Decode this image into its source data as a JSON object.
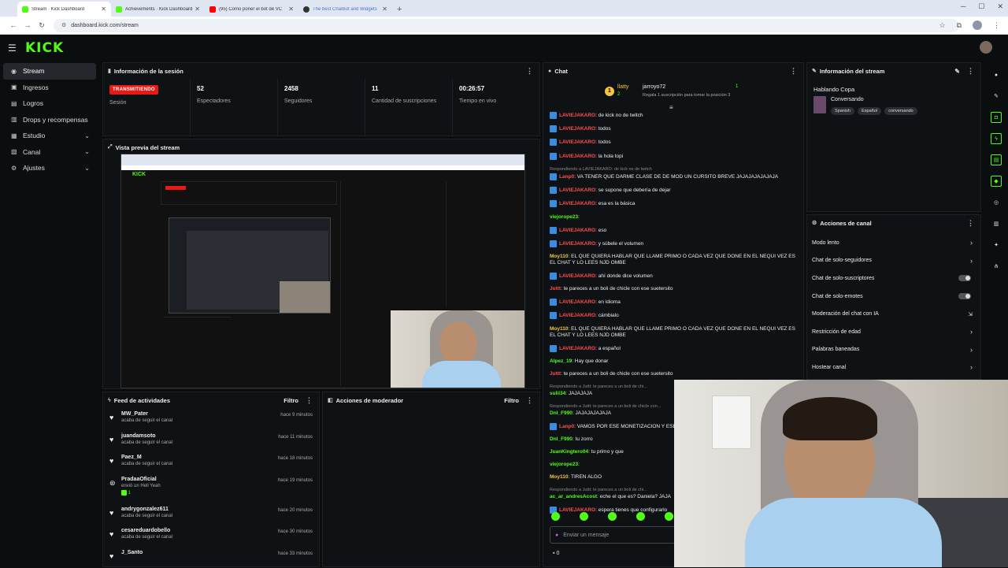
{
  "browser": {
    "tabs": [
      {
        "label": "Stream · Kick Dashboard",
        "color": "#53fc18",
        "active": true
      },
      {
        "label": "Achievements · Kick Dashboard",
        "color": "#53fc18",
        "active": false
      },
      {
        "label": "(95) Como poner el bot de VC",
        "color": "#ff0000",
        "active": false
      },
      {
        "label": "The best ChatBot and Widgets",
        "color": "#333333",
        "active": false
      }
    ],
    "url": "dashboard.kick.com/stream"
  },
  "brand": {
    "logo": "KICK",
    "accent": "#53fc18"
  },
  "sidebar": {
    "items": [
      {
        "label": "Stream",
        "icon": "broadcast-icon",
        "active": true
      },
      {
        "label": "Ingresos",
        "icon": "money-icon"
      },
      {
        "label": "Logros",
        "icon": "trophy-icon"
      },
      {
        "label": "Drops y recompensas",
        "icon": "gift-icon"
      },
      {
        "label": "Estudio",
        "icon": "studio-icon",
        "chevron": true
      },
      {
        "label": "Canal",
        "icon": "channel-icon",
        "chevron": true
      },
      {
        "label": "Ajustes",
        "icon": "settings-icon",
        "chevron": true
      }
    ]
  },
  "session": {
    "title": "Información de la sesión",
    "live_label": "TRANSMITIENDO",
    "session_label": "Sesión",
    "stats": [
      {
        "value": "52",
        "label": "Espectadores"
      },
      {
        "value": "2458",
        "label": "Seguidores"
      },
      {
        "value": "11",
        "label": "Cantidad de suscripciones"
      },
      {
        "value": "00:26:57",
        "label": "Tiempo en vivo"
      }
    ]
  },
  "preview": {
    "title": "Vista previa del stream"
  },
  "feed": {
    "title": "Feed de actividades",
    "filter": "Filtro",
    "items": [
      {
        "name": "MW_Pater",
        "sub": "acaba de seguir el canal",
        "time": "hace 9 minutos"
      },
      {
        "name": "juandamsoto",
        "sub": "acaba de seguir el canal",
        "time": "hace 11 minutos"
      },
      {
        "name": "Paez_M",
        "sub": "acaba de seguir el canal",
        "time": "hace 18 minutos"
      },
      {
        "name": "PradaaOficial",
        "sub": "envió un Hell Yeah",
        "extra": "1",
        "time": "hace 19 minutos"
      },
      {
        "name": "andrygonzalez611",
        "sub": "acaba de seguir el canal",
        "time": "hace 20 minutos"
      },
      {
        "name": "cesareduardobello",
        "sub": "acaba de seguir el canal",
        "time": "hace 30 minutos"
      },
      {
        "name": "J_Santo",
        "sub": "",
        "time": "hace 33 minutos"
      }
    ]
  },
  "moderator": {
    "title": "Acciones de moderador",
    "filter": "Filtro"
  },
  "chat": {
    "title": "Chat",
    "top_gifter": "llatty",
    "top_gifter_count": "2",
    "top_user": "jarroyo72",
    "top_user_sub": "Regala 1 suscripción para tomar la posición 3",
    "top_rank": "1",
    "messages": [
      {
        "user": "LAVIEJAKARO",
        "text": ": de kick no de twitch",
        "color": "#ff4d4d",
        "badge": true
      },
      {
        "user": "LAVIEJAKARO",
        "text": ": todos",
        "color": "#ff4d4d",
        "badge": true
      },
      {
        "user": "LAVIEJAKARO",
        "text": ": todos",
        "color": "#ff4d4d",
        "badge": true
      },
      {
        "user": "LAVIEJAKARO",
        "text": ": la hola topi",
        "color": "#ff4d4d",
        "badge": true
      },
      {
        "reply": "Respondiendo a LAVIEJAKARO: de kick no de twitch",
        "user": "Lanp0",
        "text": ": VA TENER QUE DARME CLASE DE DE MOD UN CURSITO BREVE JAJAJAJAJAJAJA",
        "color": "#ff4d4d",
        "badge": true
      },
      {
        "user": "LAVIEJAKARO",
        "text": ": se supone que debería de dejar",
        "color": "#ff4d4d",
        "badge": true
      },
      {
        "user": "LAVIEJAKARO",
        "text": ": esa es la básica",
        "color": "#ff4d4d",
        "badge": true
      },
      {
        "user": "viejorope23",
        "text": ":",
        "color": "#53fc18",
        "badge": false
      },
      {
        "user": "LAVIEJAKARO",
        "text": ": eso",
        "color": "#ff4d4d",
        "badge": true
      },
      {
        "user": "LAVIEJAKARO",
        "text": ": y súbele el volumen",
        "color": "#ff4d4d",
        "badge": true
      },
      {
        "user": "Moy110",
        "text": ": EL QUE QUIERA HABLAR QUE LLAME PRIMO O CADA VEZ QUE DONE EN EL NEQUI VEZ ES EL CHAT Y LO LEES NJD OMBE",
        "color": "#f5c542",
        "badge": false
      },
      {
        "user": "LAVIEJAKARO",
        "text": ": ahí donde dice volumen",
        "color": "#ff4d4d",
        "badge": true
      },
      {
        "user": "Juttt",
        "text": ": te pareces a un boli de chicle con ese suetersito",
        "color": "#ff4d4d",
        "badge": false
      },
      {
        "user": "LAVIEJAKARO",
        "text": ": en idioma",
        "color": "#ff4d4d",
        "badge": true
      },
      {
        "user": "LAVIEJAKARO",
        "text": ": cámbialo",
        "color": "#ff4d4d",
        "badge": true
      },
      {
        "user": "Moy110",
        "text": ": EL QUE QUIERA HABLAR QUE LLAME PRIMO O CADA VEZ QUE DONE EN EL NEQUI VEZ ES EL CHAT Y LO LEES NJD OMBE",
        "color": "#f5c542",
        "badge": false
      },
      {
        "user": "LAVIEJAKARO",
        "text": ": a español",
        "color": "#ff4d4d",
        "badge": true
      },
      {
        "user": "Alpez_19",
        "text": ": Hay que donar",
        "color": "#53fc18",
        "badge": false
      },
      {
        "user": "Juttt",
        "text": ": te pareces a un boli de chicle con ese suetersito",
        "color": "#ff4d4d",
        "badge": false
      },
      {
        "reply": "Respondiendo a Juttt: te pareces a un boli de chi...",
        "user": "sulii34",
        "text": ": JAJAJAJA",
        "color": "#53fc18",
        "badge": false
      },
      {
        "reply": "Respondiendo a Juttt: te pareces a un boli de chicle con...",
        "user": "Dnl_F990",
        "text": ": JAJAJAJAJAJA",
        "color": "#53fc18",
        "badge": false
      },
      {
        "user": "Lanp0",
        "text": ": VAMOS POR ESE MONETIZACION Y ESE",
        "color": "#ff4d4d",
        "badge": true
      },
      {
        "user": "Dnl_F990",
        "text": ": tu zorro",
        "color": "#53fc18",
        "badge": false
      },
      {
        "user": "JuanKingtero04",
        "text": ": tu primo y que",
        "color": "#53fc18",
        "badge": false
      },
      {
        "user": "viejorope23",
        "text": ":",
        "color": "#53fc18",
        "badge": false
      },
      {
        "user": "Moy110",
        "text": ": TIREN ALGO",
        "color": "#f5c542",
        "badge": false
      },
      {
        "reply": "Respondiendo a Juttt: te pareces a un boli de chi...",
        "user": "ac_ar_andresAcost",
        "text": ": eche el que es? Daniela? JAJA",
        "color": "#53fc18",
        "badge": false
      },
      {
        "user": "LAVIEJAKARO",
        "text": ": espera tienes que configurarlo",
        "color": "#ff4d4d",
        "badge": true
      }
    ],
    "input_placeholder": "Enviar un mensaje",
    "viewers_count": "0"
  },
  "stream_info": {
    "title": "Información del stream",
    "stream_title": "Hablando Copa",
    "category": "Conversando",
    "tags": [
      "Spanish",
      "Español",
      "conversando"
    ]
  },
  "channel_actions": {
    "title": "Acciones de canal",
    "items": [
      {
        "label": "Modo lento",
        "control": "arrow"
      },
      {
        "label": "Chat de solo-seguidores",
        "control": "arrow"
      },
      {
        "label": "Chat de solo-suscriptores",
        "control": "toggle"
      },
      {
        "label": "Chat de solo-emotes",
        "control": "toggle"
      },
      {
        "label": "Moderación del chat con IA",
        "control": "external"
      },
      {
        "label": "Restricción de edad",
        "control": "arrow"
      },
      {
        "label": "Palabras baneadas",
        "control": "arrow"
      },
      {
        "label": "Hostear canal",
        "control": "arrow"
      }
    ]
  }
}
